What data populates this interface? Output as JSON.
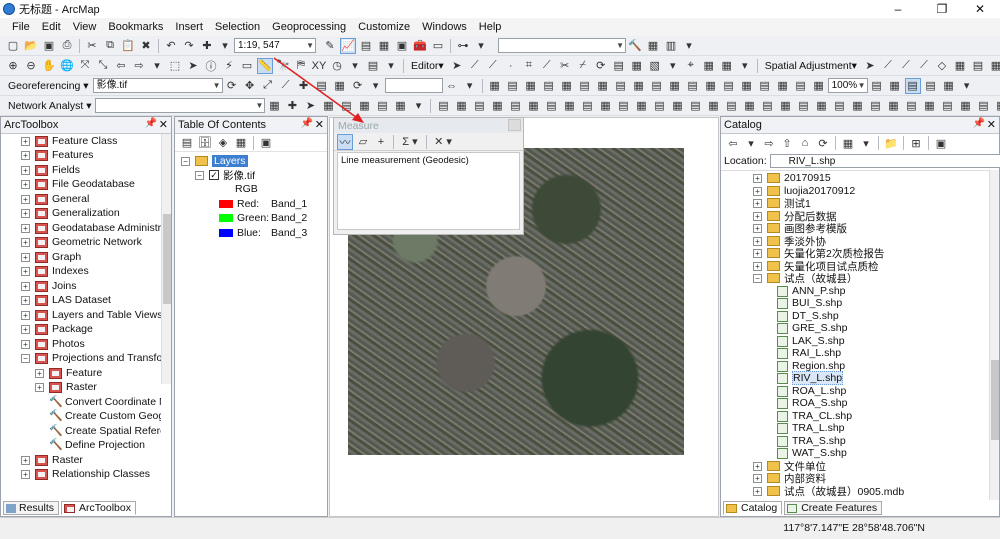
{
  "window": {
    "title": "无标题 - ArcMap",
    "controls": [
      "–",
      "❐",
      "✕"
    ]
  },
  "menu": [
    "File",
    "Edit",
    "View",
    "Bookmarks",
    "Insert",
    "Selection",
    "Geoprocessing",
    "Customize",
    "Windows",
    "Help"
  ],
  "toolbar": {
    "scale": "1:19, 547",
    "editor_label": "Editor▾",
    "spatial_adjustment_label": "Spatial Adjustment▾",
    "georeferencing_label": "Georeferencing ▾",
    "georef_layer": "影像.tif",
    "network_analyst_label": "Network Analyst ▾",
    "zoom_percent": "100%"
  },
  "arctoolbox": {
    "title": "ArcToolbox",
    "items": [
      {
        "label": "Feature Class",
        "type": "toolbox",
        "expander": "+"
      },
      {
        "label": "Features",
        "type": "toolbox",
        "expander": "+"
      },
      {
        "label": "Fields",
        "type": "toolbox",
        "expander": "+"
      },
      {
        "label": "File Geodatabase",
        "type": "toolbox",
        "expander": "+"
      },
      {
        "label": "General",
        "type": "toolbox",
        "expander": "+"
      },
      {
        "label": "Generalization",
        "type": "toolbox",
        "expander": "+"
      },
      {
        "label": "Geodatabase Administrati",
        "type": "toolbox",
        "expander": "+"
      },
      {
        "label": "Geometric Network",
        "type": "toolbox",
        "expander": "+"
      },
      {
        "label": "Graph",
        "type": "toolbox",
        "expander": "+"
      },
      {
        "label": "Indexes",
        "type": "toolbox",
        "expander": "+"
      },
      {
        "label": "Joins",
        "type": "toolbox",
        "expander": "+"
      },
      {
        "label": "LAS Dataset",
        "type": "toolbox",
        "expander": "+"
      },
      {
        "label": "Layers and Table Views",
        "type": "toolbox",
        "expander": "+"
      },
      {
        "label": "Package",
        "type": "toolbox",
        "expander": "+"
      },
      {
        "label": "Photos",
        "type": "toolbox",
        "expander": "+"
      },
      {
        "label": "Projections and Transform",
        "type": "toolbox",
        "expander": "−"
      },
      {
        "label": "Feature",
        "type": "toolbox",
        "expander": "+",
        "indent": 1
      },
      {
        "label": "Raster",
        "type": "toolbox",
        "expander": "+",
        "indent": 1
      },
      {
        "label": "Convert Coordinate No",
        "type": "tool",
        "indent": 1
      },
      {
        "label": "Create Custom Geogra",
        "type": "tool",
        "indent": 1
      },
      {
        "label": "Create Spatial Referen",
        "type": "tool",
        "indent": 1
      },
      {
        "label": "Define Projection",
        "type": "tool",
        "indent": 1
      },
      {
        "label": "Raster",
        "type": "toolbox",
        "expander": "+"
      },
      {
        "label": "Relationship Classes",
        "type": "toolbox",
        "expander": "+"
      }
    ],
    "tabs": [
      "Results",
      "ArcToolbox"
    ]
  },
  "toc": {
    "title": "Table Of Contents",
    "layers_label": "Layers",
    "layer_name": "影像.tif",
    "rgb_label": "RGB",
    "bands": [
      {
        "channel": "Red:",
        "band": "Band_1",
        "color": "#ff0000"
      },
      {
        "channel": "Green:",
        "band": "Band_2",
        "color": "#00ff00"
      },
      {
        "channel": "Blue:",
        "band": "Band_3",
        "color": "#0000ff"
      }
    ]
  },
  "measure": {
    "title": "Measure",
    "result_text": "Line measurement (Geodesic)",
    "tools": [
      "〰",
      "▱",
      "+",
      "Σ ▾",
      "✕ ▾"
    ]
  },
  "catalog": {
    "title": "Catalog",
    "location_label": "Location:",
    "location_value": "RIV_L.shp",
    "items": [
      {
        "label": "20170915",
        "type": "folder",
        "expander": "+"
      },
      {
        "label": "luojia20170912",
        "type": "folder",
        "expander": "+"
      },
      {
        "label": "测试1",
        "type": "folder",
        "expander": "+"
      },
      {
        "label": "分配后数据",
        "type": "folder",
        "expander": "+"
      },
      {
        "label": "画图参考模版",
        "type": "folder",
        "expander": "+"
      },
      {
        "label": "季淡外协",
        "type": "folder",
        "expander": "+"
      },
      {
        "label": "矢量化第2次质检报告",
        "type": "folder",
        "expander": "+"
      },
      {
        "label": "矢量化项目试点质检",
        "type": "folder",
        "expander": "+"
      },
      {
        "label": "试点（故城县）",
        "type": "folder",
        "expander": "−"
      },
      {
        "label": "ANN_P.shp",
        "type": "shp",
        "indent": 1
      },
      {
        "label": "BUI_S.shp",
        "type": "shp",
        "indent": 1
      },
      {
        "label": "DT_S.shp",
        "type": "shp",
        "indent": 1
      },
      {
        "label": "GRE_S.shp",
        "type": "shp",
        "indent": 1
      },
      {
        "label": "LAK_S.shp",
        "type": "shp",
        "indent": 1
      },
      {
        "label": "RAI_L.shp",
        "type": "shp",
        "indent": 1
      },
      {
        "label": "Region.shp",
        "type": "shp",
        "indent": 1
      },
      {
        "label": "RIV_L.shp",
        "type": "shp",
        "indent": 1
      },
      {
        "label": "ROA_L.shp",
        "type": "shp",
        "indent": 1
      },
      {
        "label": "ROA_S.shp",
        "type": "shp",
        "indent": 1
      },
      {
        "label": "TRA_CL.shp",
        "type": "shp",
        "indent": 1
      },
      {
        "label": "TRA_L.shp",
        "type": "shp",
        "indent": 1
      },
      {
        "label": "TRA_S.shp",
        "type": "shp",
        "indent": 1
      },
      {
        "label": "WAT_S.shp",
        "type": "shp",
        "indent": 1
      },
      {
        "label": "文件单位",
        "type": "folder",
        "expander": "+"
      },
      {
        "label": "内部资料",
        "type": "folder",
        "expander": "+"
      },
      {
        "label": "试点（故城县）0905.mdb",
        "type": "folder",
        "expander": "+"
      },
      {
        "label": "",
        "type": "folder",
        "expander": "+"
      }
    ],
    "tabs": [
      "Catalog",
      "Create Features"
    ]
  },
  "status": {
    "coords": "117°8'7.147\"E  28°58'48.706\"N"
  }
}
